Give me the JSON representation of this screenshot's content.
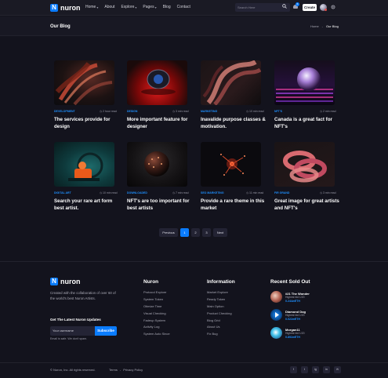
{
  "header": {
    "logo_mark": "N",
    "logo_text": "nuron",
    "nav": [
      {
        "label": "Home",
        "has_caret": true
      },
      {
        "label": "About",
        "has_caret": false
      },
      {
        "label": "Explore",
        "has_caret": true
      },
      {
        "label": "Pages",
        "has_caret": true
      },
      {
        "label": "Blog",
        "has_caret": false
      },
      {
        "label": "Contact",
        "has_caret": false
      }
    ],
    "search_placeholder": "Search Here",
    "notification_count": "6",
    "create_label": "Create"
  },
  "breadcrumb": {
    "title": "Our Blog",
    "home": "Home",
    "separator": "-",
    "current": "Our Blog"
  },
  "posts": [
    {
      "tag": "DEVELOPMENT",
      "read": "2 hour read",
      "title": "The services provide for design"
    },
    {
      "tag": "DESIGN",
      "read": "3 min read",
      "title": "More important feature for designer"
    },
    {
      "tag": "MARKETING",
      "read": "10 min read",
      "title": "Inavalide purpose classes & motivation."
    },
    {
      "tag": "NFT'S",
      "read": "2 min read",
      "title": "Canada is a great fact for NFT's"
    },
    {
      "tag": "DIGITAL ART",
      "read": "10 min read",
      "title": "Search your rare art form best artist."
    },
    {
      "tag": "DOWNLOADED",
      "read": "7 min read",
      "title": "NFT's are too important for best artists"
    },
    {
      "tag": "SEO MARKETING",
      "read": "11 min read",
      "title": "Provide a rare theme in this market"
    },
    {
      "tag": "FIR GRAND",
      "read": "3 min read",
      "title": "Great image for great artists and NFT's"
    }
  ],
  "pagination": {
    "previous": "Previous",
    "pages": [
      "1",
      "2",
      "3"
    ],
    "active": "1",
    "next": "Next"
  },
  "footer": {
    "logo_mark": "N",
    "logo_text": "nuron",
    "about": "Created with the collaboration of over 60 of the world's best Nuron Artists.",
    "newsletter_title": "Get The Latest Nuron Updates",
    "email_placeholder": "Your username",
    "subscribe_label": "Subscribe",
    "note": "Email is safe. We don't spam.",
    "nuron_title": "Nuron",
    "nuron_links": [
      "Protocol Explore",
      "System Token",
      "Otimize Time",
      "Visual Checking",
      "Fadeup System",
      "Activity Log",
      "System Auto Since"
    ],
    "info_title": "Information",
    "info_links": [
      "Market Explore",
      "Ready Token",
      "Main Option",
      "Product Checking",
      "Blog Grid",
      "About Us",
      "Fix Bug"
    ],
    "sold_title": "Recent Sold Out",
    "sold": [
      {
        "name": "#21 The Wonder",
        "sub": "Highest bid 1/20",
        "price": "0.244wETH"
      },
      {
        "name": "Diamond Dog",
        "sub": "Highest bid 1/20",
        "price": "0.022wETH"
      },
      {
        "name": "Morgan11",
        "sub": "Highest bid 1/20",
        "price": "0.892wETH"
      }
    ],
    "copyright": "© Nuron, Inc. All rights reserved.",
    "terms": "Terms",
    "legal_sep": "-",
    "privacy": "Privacy Policy",
    "socials": [
      "f",
      "t",
      "ig",
      "in",
      "✉"
    ]
  },
  "colors": {
    "background": "#13131d",
    "accent": "#0a7cff",
    "price": "#1e90ff"
  }
}
